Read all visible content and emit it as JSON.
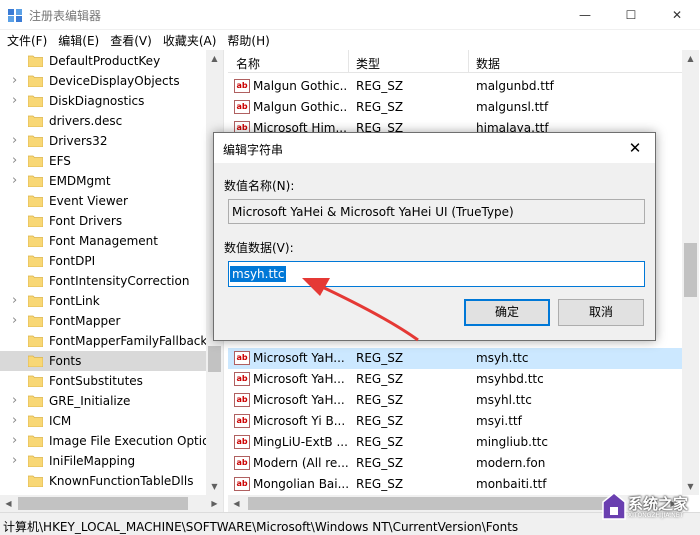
{
  "window": {
    "title": "注册表编辑器",
    "icon": "registry-editor-icon",
    "minimize_glyph": "—",
    "maximize_glyph": "☐",
    "close_glyph": "✕"
  },
  "menu": [
    {
      "label": "文件(F)"
    },
    {
      "label": "编辑(E)"
    },
    {
      "label": "查看(V)"
    },
    {
      "label": "收藏夹(A)"
    },
    {
      "label": "帮助(H)"
    }
  ],
  "tree": {
    "items": [
      {
        "label": "DefaultProductKey",
        "expandable": false,
        "selected": false
      },
      {
        "label": "DeviceDisplayObjects",
        "expandable": true,
        "selected": false
      },
      {
        "label": "DiskDiagnostics",
        "expandable": true,
        "selected": false
      },
      {
        "label": "drivers.desc",
        "expandable": false,
        "selected": false
      },
      {
        "label": "Drivers32",
        "expandable": true,
        "selected": false
      },
      {
        "label": "EFS",
        "expandable": true,
        "selected": false
      },
      {
        "label": "EMDMgmt",
        "expandable": true,
        "selected": false
      },
      {
        "label": "Event Viewer",
        "expandable": false,
        "selected": false
      },
      {
        "label": "Font Drivers",
        "expandable": false,
        "selected": false
      },
      {
        "label": "Font Management",
        "expandable": false,
        "selected": false
      },
      {
        "label": "FontDPI",
        "expandable": false,
        "selected": false
      },
      {
        "label": "FontIntensityCorrection",
        "expandable": false,
        "selected": false
      },
      {
        "label": "FontLink",
        "expandable": true,
        "selected": false
      },
      {
        "label": "FontMapper",
        "expandable": true,
        "selected": false
      },
      {
        "label": "FontMapperFamilyFallback",
        "expandable": false,
        "selected": false
      },
      {
        "label": "Fonts",
        "expandable": false,
        "selected": true
      },
      {
        "label": "FontSubstitutes",
        "expandable": false,
        "selected": false
      },
      {
        "label": "GRE_Initialize",
        "expandable": true,
        "selected": false
      },
      {
        "label": "ICM",
        "expandable": true,
        "selected": false
      },
      {
        "label": "Image File Execution Optio",
        "expandable": true,
        "selected": false
      },
      {
        "label": "IniFileMapping",
        "expandable": true,
        "selected": false
      },
      {
        "label": "KnownFunctionTableDlls",
        "expandable": false,
        "selected": false
      }
    ]
  },
  "list": {
    "columns": [
      "名称",
      "类型",
      "数据"
    ],
    "rows_top": [
      {
        "name": "Malgun Gothic...",
        "type": "REG_SZ",
        "data": "malgunbd.ttf",
        "selected": false
      },
      {
        "name": "Malgun Gothic...",
        "type": "REG_SZ",
        "data": "malgunsl.ttf",
        "selected": false
      },
      {
        "name": "Microsoft Him...",
        "type": "REG_SZ",
        "data": "himalaya.ttf",
        "selected": false
      }
    ],
    "rows_bottom": [
      {
        "name": "Microsoft YaH...",
        "type": "REG_SZ",
        "data": "msyh.ttc",
        "selected": true
      },
      {
        "name": "Microsoft YaH...",
        "type": "REG_SZ",
        "data": "msyhbd.ttc",
        "selected": false
      },
      {
        "name": "Microsoft YaH...",
        "type": "REG_SZ",
        "data": "msyhl.ttc",
        "selected": false
      },
      {
        "name": "Microsoft Yi B...",
        "type": "REG_SZ",
        "data": "msyi.ttf",
        "selected": false
      },
      {
        "name": "MingLiU-ExtB ...",
        "type": "REG_SZ",
        "data": "mingliub.ttc",
        "selected": false
      },
      {
        "name": "Modern (All re...",
        "type": "REG_SZ",
        "data": "modern.fon",
        "selected": false
      },
      {
        "name": "Mongolian Bai...",
        "type": "REG_SZ",
        "data": "monbaiti.ttf",
        "selected": false
      }
    ]
  },
  "status_path": "计算机\\HKEY_LOCAL_MACHINE\\SOFTWARE\\Microsoft\\Windows NT\\CurrentVersion\\Fonts",
  "dialog": {
    "title": "编辑字符串",
    "close_glyph": "✕",
    "name_label": "数值名称(N):",
    "name_value": "Microsoft YaHei & Microsoft YaHei UI (TrueType)",
    "data_label": "数值数据(V):",
    "data_value": "msyh.ttc",
    "ok_label": "确定",
    "cancel_label": "取消"
  },
  "colors": {
    "accent": "#0078d7",
    "selection_list": "#cce8ff",
    "annotation_arrow": "#e53935"
  },
  "watermark": {
    "text": "系统之家",
    "sub": "XITONGZHIJIA.NET"
  }
}
